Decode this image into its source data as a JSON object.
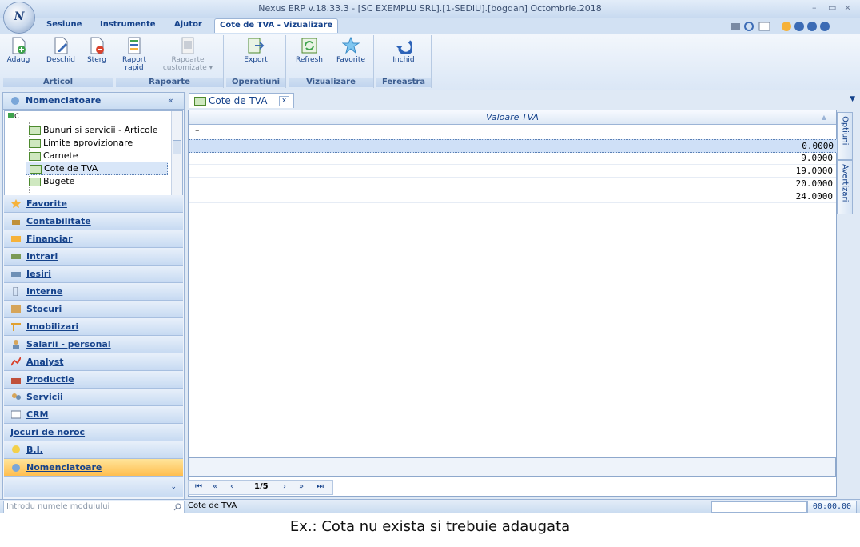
{
  "window": {
    "logo_letter": "N",
    "title": "Nexus ERP v.18.33.3 - [SC EXEMPLU SRL].[1-SEDIU].[bogdan] Octombrie.2018",
    "minimize": "–",
    "restore": "▭",
    "close": "×"
  },
  "menu": {
    "tabs": [
      "Sesiune",
      "Instrumente",
      "Ajutor",
      "Cote de TVA - Vizualizare"
    ],
    "active_tab": "Cote de TVA - Vizualizare"
  },
  "ribbon": {
    "groups": [
      {
        "label": "Articol",
        "buttons": [
          "Adaug",
          "Deschid",
          "Sterg"
        ]
      },
      {
        "label": "Rapoarte",
        "buttons": [
          "Raport rapid",
          "Rapoarte customizate ▾"
        ]
      },
      {
        "label": "Operatiuni",
        "buttons": [
          "Export"
        ]
      },
      {
        "label": "Vizualizare",
        "buttons": [
          "Refresh",
          "Favorite"
        ]
      },
      {
        "label": "Fereastra",
        "buttons": [
          "Inchid"
        ]
      }
    ]
  },
  "left_panel": {
    "title": "Nomenclatoare",
    "collapse": "«",
    "tree_root": "C",
    "tree_items": [
      "Bunuri si servicii - Articole",
      "Limite aprovizionare",
      "Carnete",
      "Cote de TVA",
      "Bugete"
    ],
    "selected_item": "Cote de TVA",
    "nav_items": [
      "Favorite",
      "Contabilitate",
      "Financiar",
      "Intrari",
      "Iesiri",
      "Interne",
      "Stocuri",
      "Imobilizari",
      "Salarii - personal",
      "Analyst",
      "Productie",
      "Servicii",
      "CRM",
      "Jocuri de noroc",
      "B.I.",
      "Nomenclatoare"
    ],
    "active_nav": "Nomenclatoare",
    "expand_more": "⌄",
    "search_placeholder": "Introdu numele modulului"
  },
  "document": {
    "tab_title": "Cote de TVA",
    "tab_close": "x",
    "column_header": "Valoare TVA",
    "filter_value": "–",
    "rows": [
      "0.0000",
      "9.0000",
      "19.0000",
      "20.0000",
      "24.0000"
    ],
    "selected_row": 0,
    "pager": {
      "first": "⏮",
      "prev_page": "«",
      "prev": "‹",
      "position": "1/5",
      "next": "›",
      "next_page": "»",
      "last": "⏭"
    },
    "side_tabs": [
      "Optiuni",
      "Avertizari"
    ]
  },
  "status": {
    "text": "Cote de TVA",
    "timer": "00:00.00"
  },
  "caption": "Ex.: Cota nu exista si trebuie adaugata"
}
